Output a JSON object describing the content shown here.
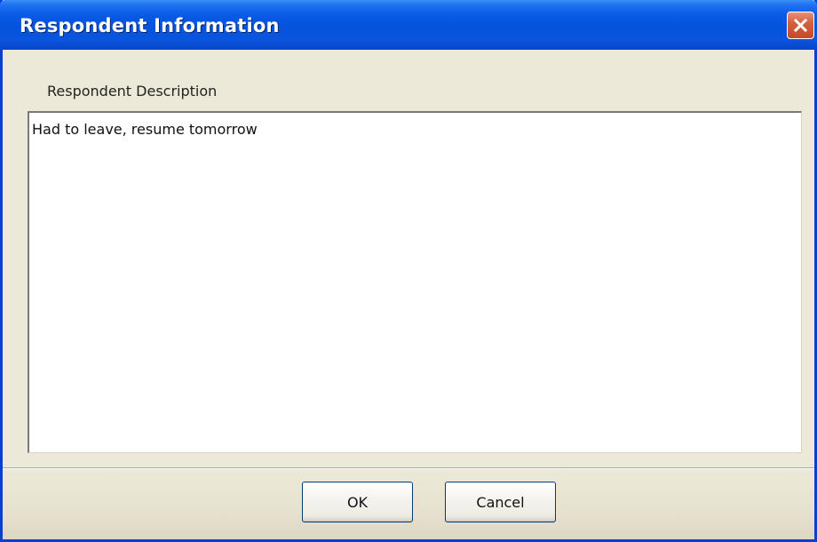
{
  "dialog": {
    "title": "Respondent Information",
    "close_icon": "close-x-icon"
  },
  "form": {
    "description_label": "Respondent Description",
    "description_value": "Had to leave, resume tomorrow"
  },
  "buttons": {
    "ok_label": "OK",
    "cancel_label": "Cancel"
  },
  "colors": {
    "titlebar": "#0552dc",
    "close_button": "#d5603f",
    "dialog_background": "#ece9d8"
  }
}
